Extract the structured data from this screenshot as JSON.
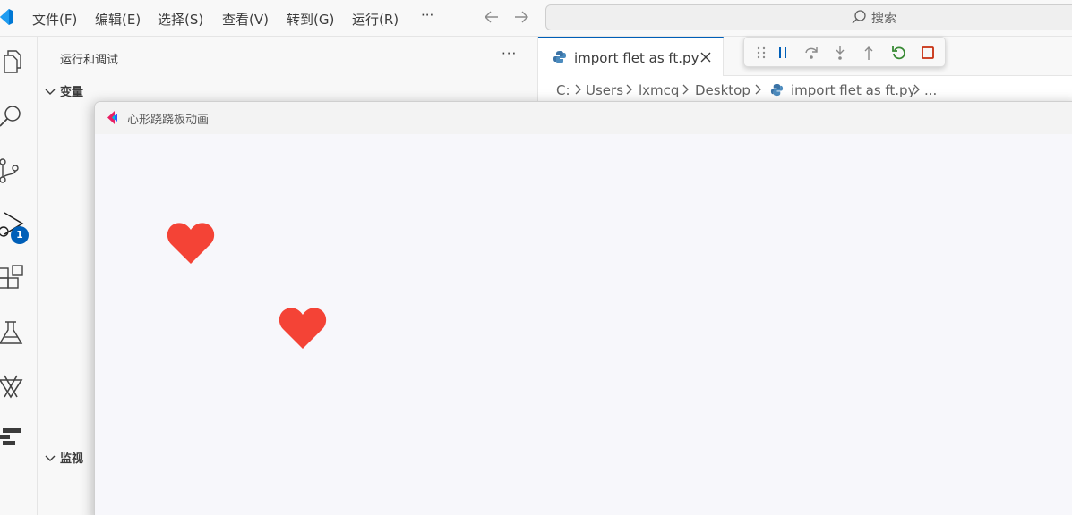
{
  "menu": {
    "items": [
      "文件(F)",
      "编辑(E)",
      "选择(S)",
      "查看(V)",
      "转到(G)",
      "运行(R)"
    ],
    "more": "···"
  },
  "search": {
    "label": "搜索"
  },
  "activity": {
    "debug_badge": "1"
  },
  "sidebar": {
    "title": "运行和调试",
    "more": "···",
    "sections": {
      "variables": "变量",
      "watch": "监视"
    }
  },
  "editor": {
    "tab_label": "import flet as ft.py",
    "breadcrumb": [
      "C:",
      "Users",
      "lxmcq",
      "Desktop",
      "import flet as ft.py",
      "..."
    ]
  },
  "app": {
    "title": "心形跷跷板动画",
    "heart_color": "#f44336",
    "hearts": [
      "heart-left",
      "heart-right"
    ]
  },
  "colors": {
    "accent": "#005fb8",
    "restart": "#388a34",
    "stop": "#c72e0f"
  }
}
